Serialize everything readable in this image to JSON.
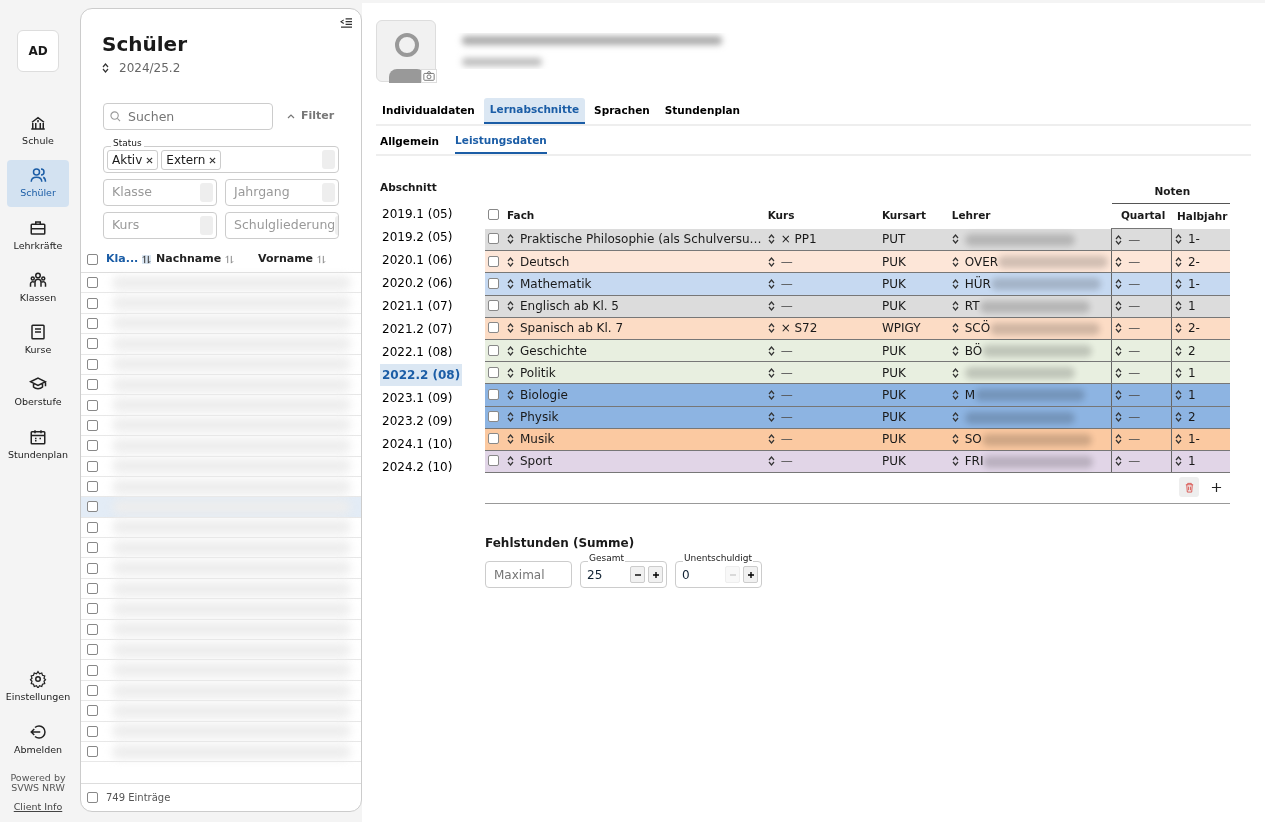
{
  "user_badge": "AD",
  "nav": [
    {
      "label": "Schule",
      "selected": false
    },
    {
      "label": "Schüler",
      "selected": true
    },
    {
      "label": "Lehrkräfte",
      "selected": false
    },
    {
      "label": "Klassen",
      "selected": false
    },
    {
      "label": "Kurse",
      "selected": false
    },
    {
      "label": "Oberstufe",
      "selected": false
    },
    {
      "label": "Stundenplan",
      "selected": false
    }
  ],
  "nav_bottom": [
    {
      "label": "Einstellungen"
    },
    {
      "label": "Abmelden"
    }
  ],
  "powered_by": "Powered by SVWS NRW",
  "client_info": "Client Info",
  "list_panel": {
    "title": "Schüler",
    "period": "2024/25.2",
    "search": {
      "placeholder": "Suchen"
    },
    "filter_button": "Filter",
    "status": {
      "label": "Status",
      "tags": [
        "Aktiv",
        "Extern"
      ]
    },
    "selects": [
      {
        "placeholder": "Klasse"
      },
      {
        "placeholder": "Jahrgang"
      },
      {
        "placeholder": "Kurs"
      },
      {
        "placeholder": "Schulgliederung"
      }
    ],
    "select_all_checked": false,
    "footer_checked": false,
    "columns": [
      {
        "label": "Kla...",
        "sorted": true
      },
      {
        "label": "Nachname",
        "sorted": false
      },
      {
        "label": "Vorname",
        "sorted": false
      }
    ],
    "rows": [
      {
        "selected": false
      },
      {
        "selected": false
      },
      {
        "selected": false
      },
      {
        "selected": false
      },
      {
        "selected": false
      },
      {
        "selected": false
      },
      {
        "selected": false
      },
      {
        "selected": false
      },
      {
        "selected": false
      },
      {
        "selected": false
      },
      {
        "selected": false
      },
      {
        "selected": true
      },
      {
        "selected": false
      },
      {
        "selected": false
      },
      {
        "selected": false
      },
      {
        "selected": false
      },
      {
        "selected": false
      },
      {
        "selected": false
      },
      {
        "selected": false
      },
      {
        "selected": false
      },
      {
        "selected": false
      },
      {
        "selected": false
      },
      {
        "selected": false
      },
      {
        "selected": false
      }
    ],
    "count": "749 Einträge"
  },
  "tabs": [
    {
      "label": "Individualdaten",
      "selected": false
    },
    {
      "label": "Lernabschnitte",
      "selected": true
    },
    {
      "label": "Sprachen",
      "selected": false
    },
    {
      "label": "Stundenplan",
      "selected": false
    }
  ],
  "subtabs": [
    {
      "label": "Allgemein",
      "selected": false
    },
    {
      "label": "Leistungsdaten",
      "selected": true
    }
  ],
  "sections": {
    "heading": "Abschnitt",
    "items": [
      {
        "label": "2019.1 (05)",
        "selected": false
      },
      {
        "label": "2019.2 (05)",
        "selected": false
      },
      {
        "label": "2020.1 (06)",
        "selected": false
      },
      {
        "label": "2020.2 (06)",
        "selected": false
      },
      {
        "label": "2021.1 (07)",
        "selected": false
      },
      {
        "label": "2021.2 (07)",
        "selected": false
      },
      {
        "label": "2022.1 (08)",
        "selected": false
      },
      {
        "label": "2022.2 (08)",
        "selected": true
      },
      {
        "label": "2023.1 (09)",
        "selected": false
      },
      {
        "label": "2023.2 (09)",
        "selected": false
      },
      {
        "label": "2024.1 (10)",
        "selected": false
      },
      {
        "label": "2024.2 (10)",
        "selected": false
      }
    ]
  },
  "grades": {
    "group_heading": "Noten",
    "select_all_checked": false,
    "columns": [
      "Fach",
      "Kurs",
      "Kursart",
      "Lehrer",
      "Quartal",
      "Halbjahr"
    ],
    "rows": [
      {
        "fach": "Praktische Philosophie (als Schulversu…",
        "kurs": "× PP1",
        "kursart": "PUT",
        "quartal": "—",
        "halbjahr": "1-",
        "color": "#dcdcdc"
      },
      {
        "fach": "Deutsch",
        "kurs": "—",
        "kursart": "PUK",
        "lehrer": "OVER",
        "quartal": "—",
        "halbjahr": "2-",
        "color": "#fde6d8"
      },
      {
        "fach": "Mathematik",
        "kurs": "—",
        "kursart": "PUK",
        "lehrer": "HÜR",
        "quartal": "—",
        "halbjahr": "1-",
        "color": "#c6d9f1"
      },
      {
        "fach": "Englisch ab Kl. 5",
        "kurs": "—",
        "kursart": "PUK",
        "lehrer": "RT",
        "quartal": "—",
        "halbjahr": "1",
        "color": "#dcdcdc"
      },
      {
        "fach": "Spanisch ab Kl. 7",
        "kurs": "× S72",
        "kursart": "WPIGY",
        "lehrer": "SCÖ",
        "quartal": "—",
        "halbjahr": "2-",
        "color": "#fcdcc5"
      },
      {
        "fach": "Geschichte",
        "kurs": "—",
        "kursart": "PUK",
        "lehrer": "BÖ",
        "quartal": "—",
        "halbjahr": "2",
        "color": "#e8efe0"
      },
      {
        "fach": "Politik",
        "kurs": "—",
        "kursart": "PUK",
        "quartal": "—",
        "halbjahr": "1",
        "color": "#e8efe0"
      },
      {
        "fach": "Biologie",
        "kurs": "—",
        "kursart": "PUK",
        "lehrer": "M",
        "quartal": "—",
        "halbjahr": "1",
        "color": "#8db4e2"
      },
      {
        "fach": "Physik",
        "kurs": "—",
        "kursart": "PUK",
        "quartal": "—",
        "halbjahr": "2",
        "color": "#8db4e2"
      },
      {
        "fach": "Musik",
        "kurs": "—",
        "kursart": "PUK",
        "lehrer": "SO",
        "quartal": "—",
        "halbjahr": "1-",
        "color": "#fbc9a1"
      },
      {
        "fach": "Sport",
        "kurs": "—",
        "kursart": "PUK",
        "lehrer": "FRI",
        "quartal": "—",
        "halbjahr": "1",
        "color": "#e1d5e7"
      }
    ]
  },
  "absences": {
    "heading": "Fehlstunden (Summe)",
    "max": {
      "placeholder": "Maximal"
    },
    "total": {
      "label": "Gesamt",
      "value": "25"
    },
    "unexcused": {
      "label": "Unentschuldigt",
      "value": "0"
    }
  }
}
